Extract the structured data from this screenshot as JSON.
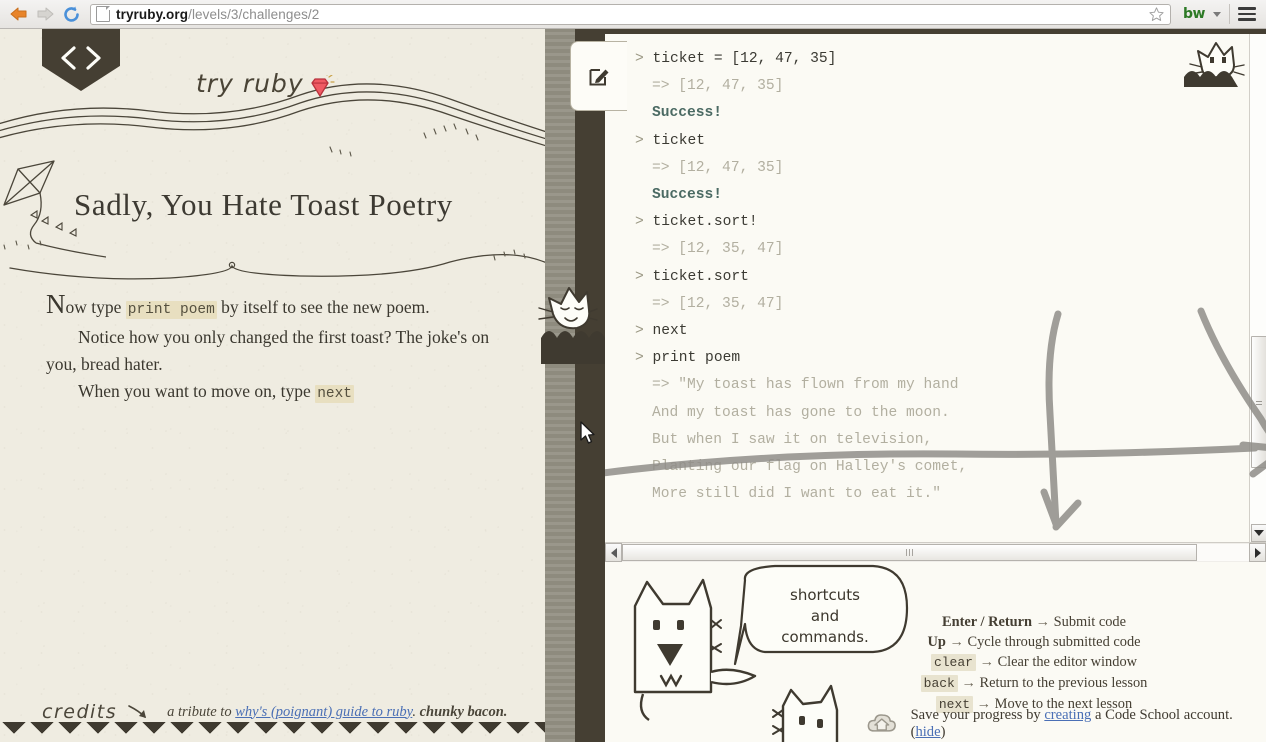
{
  "browser": {
    "back_label": "Back",
    "forward_label": "Forward",
    "reload_label": "Reload",
    "url_host": "tryruby.org",
    "url_path": "/levels/3/challenges/2",
    "bookmark_label": "Bookmark this page",
    "extension_label": "bw",
    "menu_label": "Open menu"
  },
  "lesson": {
    "brand": "try ruby",
    "title": "Sadly, You Hate Toast Poetry",
    "para1_lead": "N",
    "para1_a": "ow type ",
    "para1_code": "print poem",
    "para1_b": " by itself to see the new poem.",
    "para2": "Notice how you only changed the first toast? The joke's on you, bread hater.",
    "para3_a": "When you want to move on, type ",
    "para3_code": "next",
    "credits_word": "credits",
    "credits_prefix": "a tribute to ",
    "credits_link": "why's (poignant) guide to ruby",
    "credits_middle": ". ",
    "credits_bold": "chunky bacon."
  },
  "console": {
    "editor_icon": "edit-pencil-icon",
    "lines": [
      {
        "type": "cmd",
        "prompt": ">",
        "text": "ticket = [12, 47, 35]"
      },
      {
        "type": "ret",
        "text": "=> [12, 47, 35]"
      },
      {
        "type": "success",
        "text": "Success!"
      },
      {
        "type": "cmd",
        "prompt": ">",
        "text": "ticket"
      },
      {
        "type": "ret",
        "text": "=> [12, 47, 35]"
      },
      {
        "type": "success",
        "text": "Success!"
      },
      {
        "type": "cmd",
        "prompt": ">",
        "text": "ticket.sort!"
      },
      {
        "type": "ret",
        "text": "=> [12, 35, 47]"
      },
      {
        "type": "cmd",
        "prompt": ">",
        "text": "ticket.sort"
      },
      {
        "type": "ret",
        "text": "=> [12, 35, 47]"
      },
      {
        "type": "cmd",
        "prompt": ">",
        "text": "next"
      },
      {
        "type": "cmd",
        "prompt": ">",
        "text": "print poem"
      },
      {
        "type": "ret",
        "text": "=> \"My toast has flown from my hand"
      },
      {
        "type": "ret",
        "text": "And my toast has gone to the moon."
      },
      {
        "type": "ret",
        "text": "But when I saw it on television,"
      },
      {
        "type": "ret",
        "text": "Planting our flag on Halley's comet,"
      },
      {
        "type": "ret",
        "text": "More still did I want to eat it.\""
      }
    ]
  },
  "mascot": {
    "bubble_line1": "shortcuts",
    "bubble_line2": "and",
    "bubble_line3": "commands."
  },
  "shortcuts": [
    {
      "key": "Enter / Return",
      "style": "bold",
      "arrow": "→",
      "desc": "Submit code"
    },
    {
      "key": "Up",
      "style": "bold",
      "arrow": "→",
      "desc": "Cycle through submitted code"
    },
    {
      "key": "clear",
      "style": "code",
      "arrow": "→",
      "desc": "Clear the editor window"
    },
    {
      "key": "back",
      "style": "code",
      "arrow": "→",
      "desc": "Return to the previous lesson"
    },
    {
      "key": "next",
      "style": "code",
      "arrow": "→",
      "desc": "Move to the next lesson"
    }
  ],
  "savebar": {
    "prefix": "Save your progress by ",
    "link": "creating",
    "middle": " a Code School account. (",
    "hide": "hide",
    "suffix": ")"
  },
  "colors": {
    "paper": "#efece1",
    "ink": "#3d3a32",
    "dark_panel": "#453f33",
    "code_highlight": "#e8dfc0",
    "success": "#4b6a63",
    "link": "#4a6fb5",
    "ruby_red": "#e8505b"
  }
}
